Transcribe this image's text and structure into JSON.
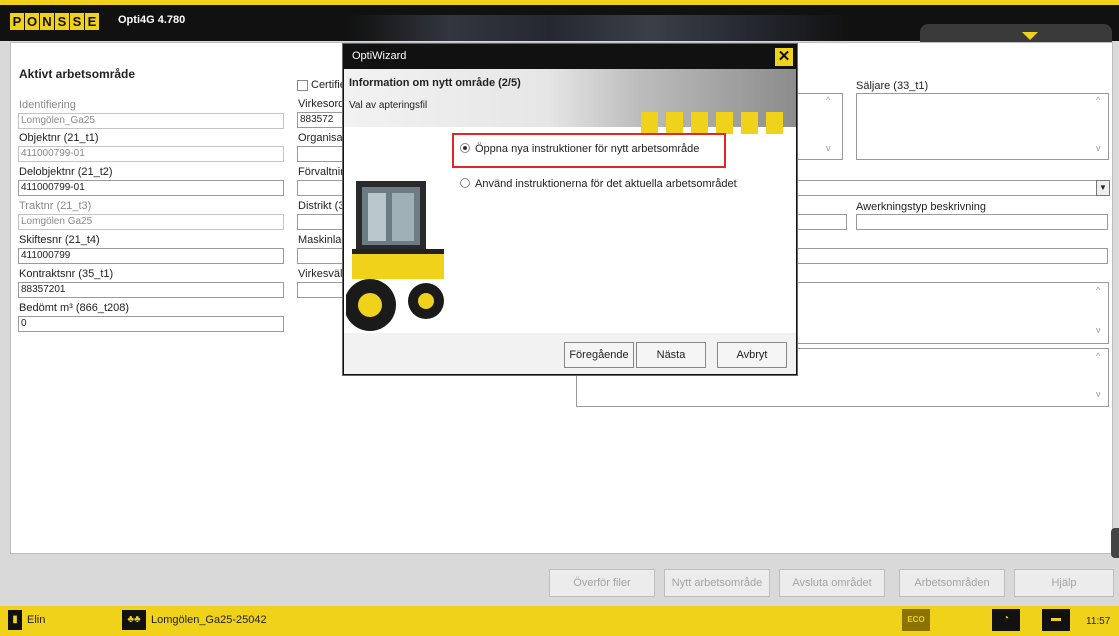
{
  "app": {
    "logo": "PONSSE",
    "title": "Opti4G 4.780"
  },
  "form": {
    "section_title": "Aktivt arbetsområde",
    "left": [
      {
        "label": "Identifiering",
        "value": "Lomgölen_Ga25"
      },
      {
        "label": "Objektnr (21_t1)",
        "value": "411000799-01"
      },
      {
        "label": "Delobjektnr (21_t2)",
        "value": "411000799-01"
      },
      {
        "label": "Traktnr (21_t3)",
        "value": "Lomgölen Ga25"
      },
      {
        "label": "Skiftesnr (21_t4)",
        "value": "411000799"
      },
      {
        "label": "Kontraktsnr (35_t1)",
        "value": "88357201"
      },
      {
        "label": "Bedömt m³ (866_t208)",
        "value": "0"
      }
    ],
    "mid": {
      "certifie": "Certifie",
      "virkesord_label": "Virkesord",
      "virkesord_value": "883572",
      "organisat": "Organisat",
      "forvaltnin": "Förvaltnin",
      "distrikt": "Distrikt (3",
      "maskinlag": "Maskinlag",
      "virkesvalt": "Virkesvält"
    },
    "right": {
      "saljare": "Säljare (33_t1)",
      "awerkning": "Awerkningstyp beskrivning"
    }
  },
  "buttons": [
    "Överför filer",
    "Nytt arbetsområde",
    "Avsluta området",
    "Arbetsområden",
    "Hjälp"
  ],
  "status": {
    "user": "Elin",
    "area": "Lomgölen_Ga25-25042",
    "eco": "ECO",
    "time": "11:57"
  },
  "dialog": {
    "title": "OptiWizard",
    "heading": "Information om nytt område (2/5)",
    "subheading": "Val av apteringsfil",
    "options": [
      {
        "label": "Öppna nya instruktioner för nytt arbetsområde",
        "selected": true
      },
      {
        "label": "Använd instruktionerna för det aktuella arbetsområdet",
        "selected": false
      }
    ],
    "buttons": {
      "prev": "Föregående",
      "next": "Nästa",
      "cancel": "Avbryt"
    }
  }
}
